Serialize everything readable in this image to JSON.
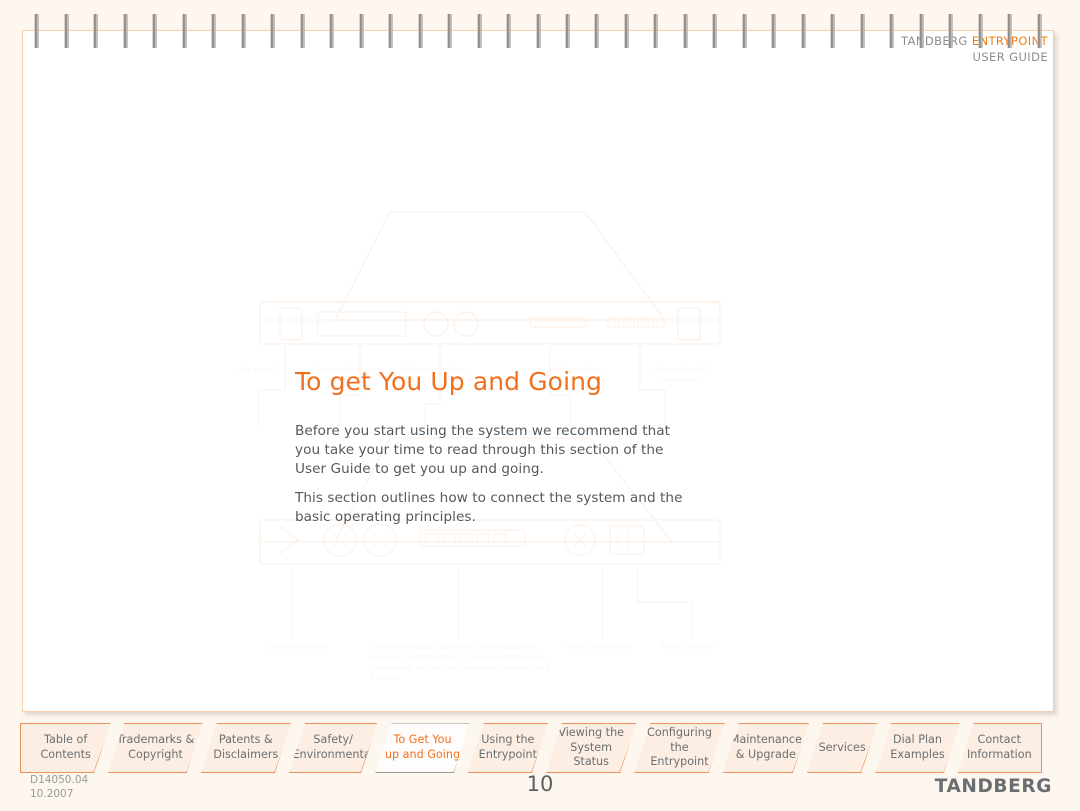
{
  "header": {
    "brand": "TANDBERG",
    "product": "ENTRYPOINT",
    "subtitle": "USER GUIDE",
    "accent_color": "#f07d1a"
  },
  "content": {
    "title": "To get You Up and Going",
    "paragraphs": [
      "Before you start using the system we recommend that you take your time to read through this section of the User Guide to get you up and going.",
      "This section outlines how to connect the system and the basic operating principles."
    ]
  },
  "watermark": {
    "top_labels": [
      "LCD panel",
      "Navigation keys",
      "Software option keys",
      "LAN interface",
      "Power On/Off indicator"
    ],
    "bottom_labels": [
      "VGA connector",
      "1 PRI interface, activated individually by software option keys, or 4 G.703 interfaces depending on the configuration chosen, and 4 LEDs.",
      "Power connector",
      "Power switch"
    ]
  },
  "tabs": [
    {
      "label_line1": "Table of",
      "label_line2": "Contents",
      "active": false
    },
    {
      "label_line1": "Trademarks &",
      "label_line2": "Copyright",
      "active": false
    },
    {
      "label_line1": "Patents &",
      "label_line2": "Disclaimers",
      "active": false
    },
    {
      "label_line1": "Safety/",
      "label_line2": "Environmental",
      "active": false
    },
    {
      "label_line1": "To Get You",
      "label_line2": "up and Going",
      "active": true
    },
    {
      "label_line1": "Using the",
      "label_line2": "Entrypoint",
      "active": false
    },
    {
      "label_line1": "Viewing the",
      "label_line2": "System Status",
      "active": false
    },
    {
      "label_line1": "Configuring",
      "label_line2": "the Entrypoint",
      "active": false
    },
    {
      "label_line1": "Maintenance",
      "label_line2": "& Upgrade",
      "active": false
    },
    {
      "label_line1": "Services",
      "label_line2": "",
      "active": false
    },
    {
      "label_line1": "Dial Plan",
      "label_line2": "Examples",
      "active": false
    },
    {
      "label_line1": "Contact",
      "label_line2": "Information",
      "active": false
    }
  ],
  "footer": {
    "doc_number": "D14050.04",
    "doc_date": "10.2007",
    "page_number": "10",
    "logo": "TANDBERG"
  }
}
